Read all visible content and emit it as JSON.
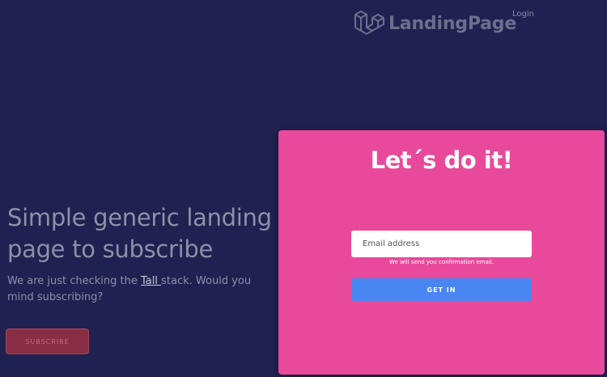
{
  "header": {
    "brand_name": "LandingPage",
    "login_label": "Login",
    "logo_icon": "laravel-logo-icon"
  },
  "hero": {
    "title": "Simple generic landing page to subscribe",
    "subtitle_before": "We are just checking the ",
    "subtitle_link": "Tall ",
    "subtitle_after": "stack. Would you mind subscribing?",
    "subscribe_label": "SUBSCRIBE"
  },
  "modal": {
    "title": "Let´s do it!",
    "email_placeholder": "Email address",
    "email_value": "",
    "hint": "We will send you confirmation email.",
    "submit_label": "GET IN"
  },
  "colors": {
    "background": "#1f2150",
    "modal": "#e9499b",
    "primary_button": "#4a86f1",
    "subscribe_button": "#872e44"
  }
}
